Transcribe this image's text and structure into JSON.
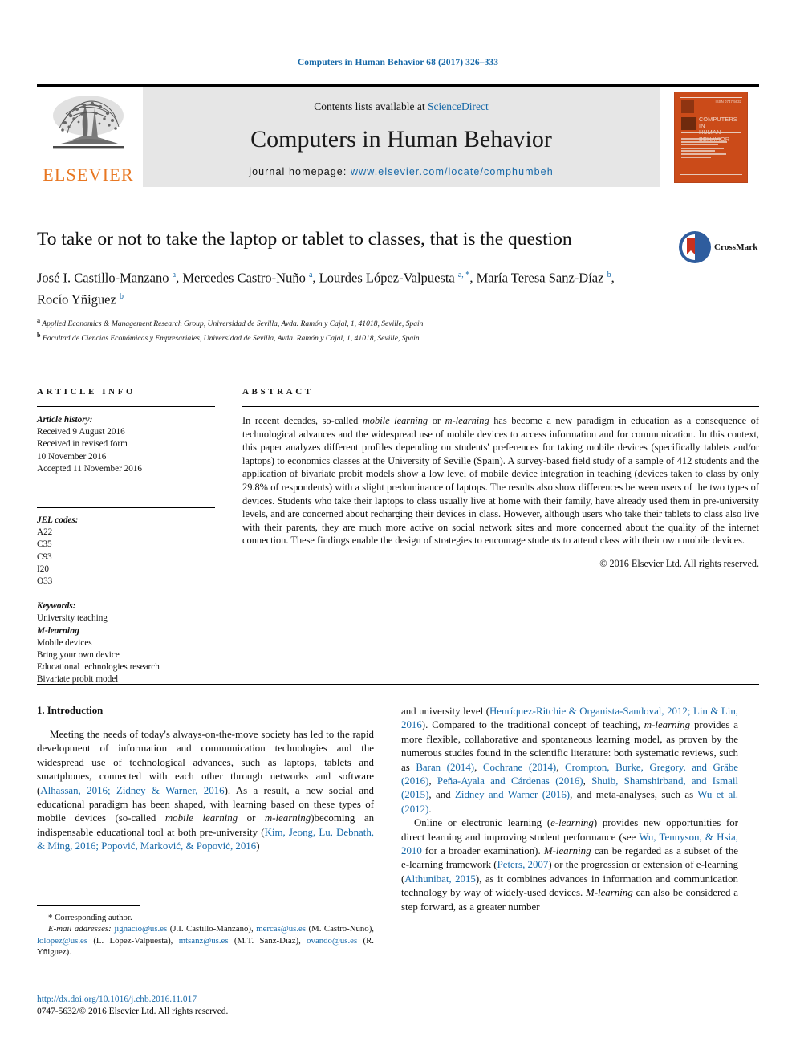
{
  "running_head": "Computers in Human Behavior 68 (2017) 326–333",
  "masthead": {
    "publisher_name": "ELSEVIER",
    "contents_prefix": "Contents lists available at ",
    "contents_link": "ScienceDirect",
    "journal_title": "Computers in Human Behavior",
    "homepage_label": "journal homepage:",
    "homepage_url": "www.elsevier.com/locate/comphumbeh",
    "cover": {
      "title_line1": "COMPUTERS IN",
      "title_line2": "HUMAN BEHAVIOR",
      "code": "ISSN 0747-5632"
    }
  },
  "article": {
    "title": "To take or not to take the laptop or tablet to classes, that is the question",
    "authors_line1_parts": [
      {
        "text": "José I. Castillo-Manzano ",
        "sup": "a"
      },
      {
        "text": ", Mercedes Castro-Nuño ",
        "sup": "a"
      },
      {
        "text": ", Lourdes López-Valpuesta ",
        "sup": "a, *"
      }
    ],
    "authors_html": "José I. Castillo-Manzano <sup>a</sup>, Mercedes Castro-Nuño <sup>a</sup>, Lourdes López-Valpuesta <sup>a, *</sup>, María Teresa Sanz-Díaz <sup>b</sup>, Rocío Yñiguez <sup>b</sup>",
    "affiliations": [
      {
        "marker": "a",
        "text": "Applied Economics & Management Research Group, Universidad de Sevilla, Avda. Ramón y Cajal, 1, 41018, Seville, Spain"
      },
      {
        "marker": "b",
        "text": "Facultad de Ciencias Económicas y Empresariales, Universidad de Sevilla, Avda. Ramón y Cajal, 1, 41018, Seville, Spain"
      }
    ],
    "crossmark_label": "CrossMark"
  },
  "article_info": {
    "heading": "ARTICLE INFO",
    "history_label": "Article history:",
    "history": [
      "Received 9 August 2016",
      "Received in revised form",
      "10 November 2016",
      "Accepted 11 November 2016"
    ],
    "jel_label": "JEL codes:",
    "jel_codes": [
      "A22",
      "C35",
      "C93",
      "I20",
      "O33"
    ],
    "keywords_label": "Keywords:",
    "keywords": [
      "University teaching",
      "M-learning",
      "Mobile devices",
      "Bring your own device",
      "Educational technologies research",
      "Bivariate probit model"
    ]
  },
  "abstract": {
    "heading": "ABSTRACT",
    "text_html": "In recent decades, so-called <em>mobile learning</em> or <em>m-learning</em> has become a new paradigm in education as a consequence of technological advances and the widespread use of mobile devices to access information and for communication. In this context, this paper analyzes different profiles depending on students' preferences for taking mobile devices (specifically tablets and/or laptops) to economics classes at the University of Seville (Spain). A survey-based field study of a sample of 412 students and the application of bivariate probit models show a low level of mobile device integration in teaching (devices taken to class by only 29.8% of respondents) with a slight predominance of laptops. The results also show differences between users of the two types of devices. Students who take their laptops to class usually live at home with their family, have already used them in pre-university levels, and are concerned about recharging their devices in class. However, although users who take their tablets to class also live with their parents, they are much more active on social network sites and more concerned about the quality of the internet connection. These findings enable the design of strategies to encourage students to attend class with their own mobile devices.",
    "copyright": "© 2016 Elsevier Ltd. All rights reserved."
  },
  "body": {
    "section_heading": "1. Introduction",
    "left_paragraph_html": "Meeting the needs of today's always-on-the-move society has led to the rapid development of information and communication technologies and the widespread use of technological advances, such as laptops, tablets and smartphones, connected with each other through networks and software (<span class=\"ref\">Alhassan, 2016; Zidney &amp; Warner, 2016</span>). As a result, a new social and educational paradigm has been shaped, with learning based on these types of mobile devices (so-called <em>mobile learning</em> or <em>m-learning</em>)becoming an indispensable educational tool at both pre-university (<span class=\"ref\">Kim, Jeong, Lu, Debnath, &amp; Ming, 2016; Popović, Marković, &amp; Popović, 2016</span>)",
    "right_paragraph1_html": "and university level (<span class=\"ref\">Henríquez-Ritchie &amp; Organista-Sandoval, 2012; Lin &amp; Lin, 2016</span>). Compared to the traditional concept of teaching, <em>m-learning</em> provides a more flexible, collaborative and spontaneous learning model, as proven by the numerous studies found in the scientific literature: both systematic reviews, such as <span class=\"ref\">Baran (2014)</span>, <span class=\"ref\">Cochrane (2014)</span>, <span class=\"ref\">Crompton, Burke, Gregory, and Gräbe (2016)</span>, <span class=\"ref\">Peña-Ayala and Cárdenas (2016)</span>, <span class=\"ref\">Shuib, Shamshirband, and Ismail (2015)</span>, and <span class=\"ref\">Zidney and Warner (2016)</span>, and meta-analyses, such as <span class=\"ref\">Wu et al. (2012)</span>.",
    "right_paragraph2_html": "Online or electronic learning (<em>e-learning</em>) provides new opportunities for direct learning and improving student performance (see <span class=\"ref\">Wu, Tennyson, &amp; Hsia, 2010</span> for a broader examination). <em>M-learning</em> can be regarded as a subset of the e-learning framework (<span class=\"ref\">Peters, 2007</span>) or the progression or extension of e-learning (<span class=\"ref\">Althunibat, 2015</span>), as it combines advances in information and communication technology by way of widely-used devices. <em>M-learning</em> can also be considered a step forward, as a greater number"
  },
  "footnote": {
    "corresponding_author": "* Corresponding author.",
    "emails_html": "<span class=\"ital\">E-mail addresses:</span> <span class=\"ref\">jignacio@us.es</span> (J.I. Castillo-Manzano), <span class=\"ref\">mercas@us.es</span> (M. Castro-Nuño), <span class=\"ref\">lolopez@us.es</span> (L. López-Valpuesta), <span class=\"ref\">mtsanz@us.es</span> (M.T. Sanz-Díaz), <span class=\"ref\">ovando@us.es</span> (R. Yñiguez)."
  },
  "doi": {
    "url": "http://dx.doi.org/10.1016/j.chb.2016.11.017",
    "issn_line": "0747-5632/© 2016 Elsevier Ltd. All rights reserved."
  },
  "colors": {
    "link_blue": "#1668a8",
    "elsevier_orange": "#E87722",
    "cover_orange": "#cb4b19",
    "band_gray": "#e6e6e6"
  }
}
